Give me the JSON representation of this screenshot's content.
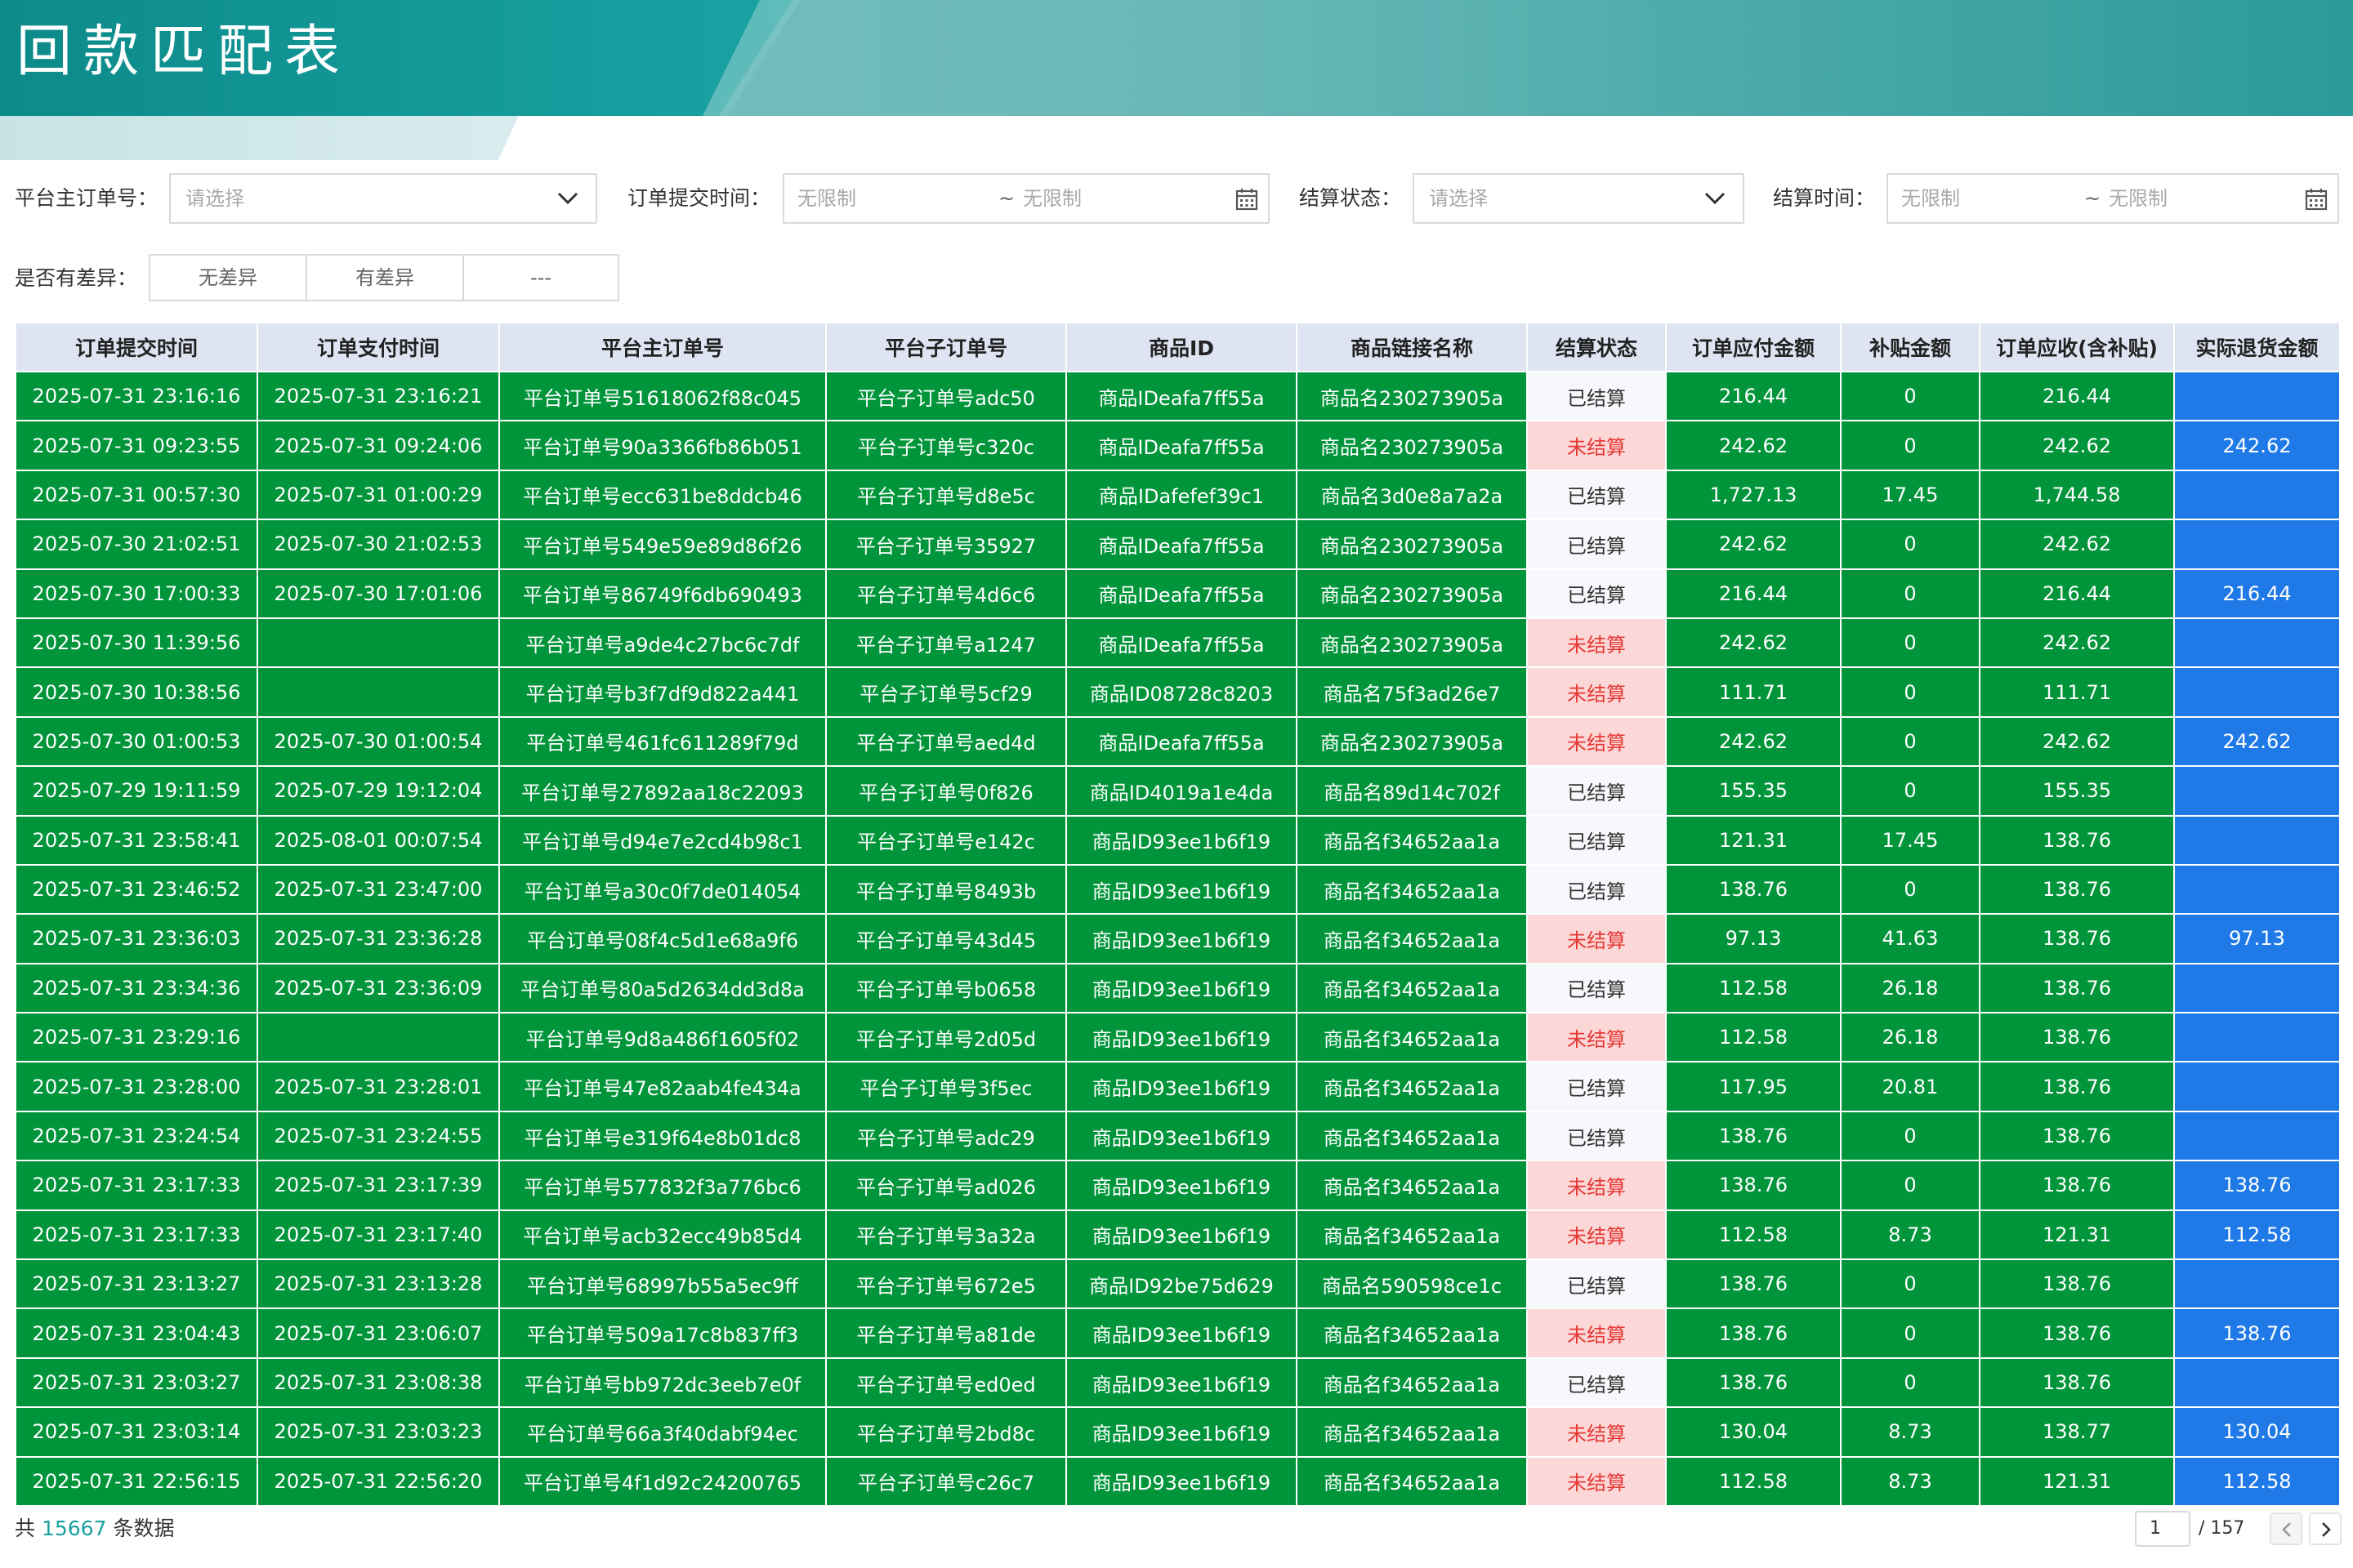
{
  "page": {
    "title": "回款匹配表"
  },
  "filters": {
    "main_order": {
      "label": "平台主订单号：",
      "placeholder": "请选择"
    },
    "submit_time": {
      "label": "订单提交时间：",
      "start": "无限制",
      "sep": "~",
      "end": "无限制"
    },
    "settle_status": {
      "label": "结算状态：",
      "placeholder": "请选择"
    },
    "settle_time": {
      "label": "结算时间：",
      "start": "无限制",
      "sep": "~",
      "end": "无限制"
    },
    "diff": {
      "label": "是否有差异：",
      "options": [
        "无差异",
        "有差异",
        "---"
      ]
    }
  },
  "table": {
    "columns": [
      "订单提交时间",
      "订单支付时间",
      "平台主订单号",
      "平台子订单号",
      "商品ID",
      "商品链接名称",
      "结算状态",
      "订单应付金额",
      "补贴金额",
      "订单应收(含补贴)",
      "实际退货金额"
    ],
    "rows": [
      [
        "2025-07-31 23:16:16",
        "2025-07-31 23:16:21",
        "平台订单号51618062f88c045",
        "平台子订单号adc50",
        "商品IDeafa7ff55a",
        "商品名230273905a",
        "已结算",
        "216.44",
        "0",
        "216.44",
        ""
      ],
      [
        "2025-07-31 09:23:55",
        "2025-07-31 09:24:06",
        "平台订单号90a3366fb86b051",
        "平台子订单号c320c",
        "商品IDeafa7ff55a",
        "商品名230273905a",
        "未结算",
        "242.62",
        "0",
        "242.62",
        "242.62"
      ],
      [
        "2025-07-31 00:57:30",
        "2025-07-31 01:00:29",
        "平台订单号ecc631be8ddcb46",
        "平台子订单号d8e5c",
        "商品IDafefef39c1",
        "商品名3d0e8a7a2a",
        "已结算",
        "1,727.13",
        "17.45",
        "1,744.58",
        ""
      ],
      [
        "2025-07-30 21:02:51",
        "2025-07-30 21:02:53",
        "平台订单号549e59e89d86f26",
        "平台子订单号35927",
        "商品IDeafa7ff55a",
        "商品名230273905a",
        "已结算",
        "242.62",
        "0",
        "242.62",
        ""
      ],
      [
        "2025-07-30 17:00:33",
        "2025-07-30 17:01:06",
        "平台订单号86749f6db690493",
        "平台子订单号4d6c6",
        "商品IDeafa7ff55a",
        "商品名230273905a",
        "已结算",
        "216.44",
        "0",
        "216.44",
        "216.44"
      ],
      [
        "2025-07-30 11:39:56",
        "",
        "平台订单号a9de4c27bc6c7df",
        "平台子订单号a1247",
        "商品IDeafa7ff55a",
        "商品名230273905a",
        "未结算",
        "242.62",
        "0",
        "242.62",
        ""
      ],
      [
        "2025-07-30 10:38:56",
        "",
        "平台订单号b3f7df9d822a441",
        "平台子订单号5cf29",
        "商品ID08728c8203",
        "商品名75f3ad26e7",
        "未结算",
        "111.71",
        "0",
        "111.71",
        ""
      ],
      [
        "2025-07-30 01:00:53",
        "2025-07-30 01:00:54",
        "平台订单号461fc611289f79d",
        "平台子订单号aed4d",
        "商品IDeafa7ff55a",
        "商品名230273905a",
        "未结算",
        "242.62",
        "0",
        "242.62",
        "242.62"
      ],
      [
        "2025-07-29 19:11:59",
        "2025-07-29 19:12:04",
        "平台订单号27892aa18c22093",
        "平台子订单号0f826",
        "商品ID4019a1e4da",
        "商品名89d14c702f",
        "已结算",
        "155.35",
        "0",
        "155.35",
        ""
      ],
      [
        "2025-07-31 23:58:41",
        "2025-08-01 00:07:54",
        "平台订单号d94e7e2cd4b98c1",
        "平台子订单号e142c",
        "商品ID93ee1b6f19",
        "商品名f34652aa1a",
        "已结算",
        "121.31",
        "17.45",
        "138.76",
        ""
      ],
      [
        "2025-07-31 23:46:52",
        "2025-07-31 23:47:00",
        "平台订单号a30c0f7de014054",
        "平台子订单号8493b",
        "商品ID93ee1b6f19",
        "商品名f34652aa1a",
        "已结算",
        "138.76",
        "0",
        "138.76",
        ""
      ],
      [
        "2025-07-31 23:36:03",
        "2025-07-31 23:36:28",
        "平台订单号08f4c5d1e68a9f6",
        "平台子订单号43d45",
        "商品ID93ee1b6f19",
        "商品名f34652aa1a",
        "未结算",
        "97.13",
        "41.63",
        "138.76",
        "97.13"
      ],
      [
        "2025-07-31 23:34:36",
        "2025-07-31 23:36:09",
        "平台订单号80a5d2634dd3d8a",
        "平台子订单号b0658",
        "商品ID93ee1b6f19",
        "商品名f34652aa1a",
        "已结算",
        "112.58",
        "26.18",
        "138.76",
        ""
      ],
      [
        "2025-07-31 23:29:16",
        "",
        "平台订单号9d8a486f1605f02",
        "平台子订单号2d05d",
        "商品ID93ee1b6f19",
        "商品名f34652aa1a",
        "未结算",
        "112.58",
        "26.18",
        "138.76",
        ""
      ],
      [
        "2025-07-31 23:28:00",
        "2025-07-31 23:28:01",
        "平台订单号47e82aab4fe434a",
        "平台子订单号3f5ec",
        "商品ID93ee1b6f19",
        "商品名f34652aa1a",
        "已结算",
        "117.95",
        "20.81",
        "138.76",
        ""
      ],
      [
        "2025-07-31 23:24:54",
        "2025-07-31 23:24:55",
        "平台订单号e319f64e8b01dc8",
        "平台子订单号adc29",
        "商品ID93ee1b6f19",
        "商品名f34652aa1a",
        "已结算",
        "138.76",
        "0",
        "138.76",
        ""
      ],
      [
        "2025-07-31 23:17:33",
        "2025-07-31 23:17:39",
        "平台订单号577832f3a776bc6",
        "平台子订单号ad026",
        "商品ID93ee1b6f19",
        "商品名f34652aa1a",
        "未结算",
        "138.76",
        "0",
        "138.76",
        "138.76"
      ],
      [
        "2025-07-31 23:17:33",
        "2025-07-31 23:17:40",
        "平台订单号acb32ecc49b85d4",
        "平台子订单号3a32a",
        "商品ID93ee1b6f19",
        "商品名f34652aa1a",
        "未结算",
        "112.58",
        "8.73",
        "121.31",
        "112.58"
      ],
      [
        "2025-07-31 23:13:27",
        "2025-07-31 23:13:28",
        "平台订单号68997b55a5ec9ff",
        "平台子订单号672e5",
        "商品ID92be75d629",
        "商品名590598ce1c",
        "已结算",
        "138.76",
        "0",
        "138.76",
        ""
      ],
      [
        "2025-07-31 23:04:43",
        "2025-07-31 23:06:07",
        "平台订单号509a17c8b837ff3",
        "平台子订单号a81de",
        "商品ID93ee1b6f19",
        "商品名f34652aa1a",
        "未结算",
        "138.76",
        "0",
        "138.76",
        "138.76"
      ],
      [
        "2025-07-31 23:03:27",
        "2025-07-31 23:08:38",
        "平台订单号bb972dc3eeb7e0f",
        "平台子订单号ed0ed",
        "商品ID93ee1b6f19",
        "商品名f34652aa1a",
        "已结算",
        "138.76",
        "0",
        "138.76",
        ""
      ],
      [
        "2025-07-31 23:03:14",
        "2025-07-31 23:03:23",
        "平台订单号66a3f40dabf94ec",
        "平台子订单号2bd8c",
        "商品ID93ee1b6f19",
        "商品名f34652aa1a",
        "未结算",
        "130.04",
        "8.73",
        "138.77",
        "130.04"
      ],
      [
        "2025-07-31 22:56:15",
        "2025-07-31 22:56:20",
        "平台订单号4f1d92c24200765",
        "平台子订单号c26c7",
        "商品ID93ee1b6f19",
        "商品名f34652aa1a",
        "未结算",
        "112.58",
        "8.73",
        "121.31",
        "112.58"
      ]
    ]
  },
  "footer": {
    "total_prefix": "共",
    "total_count": "15667",
    "total_suffix": "条数据"
  },
  "pagination": {
    "current": "1",
    "total": "/ 157"
  },
  "colors": {
    "row_green": "#00953a",
    "refund_blue": "#1f7ae8",
    "unsettled_bg": "#fcd7d7",
    "unsettled_text": "#e53935",
    "header_teal": "#0e8f8f",
    "accent_teal": "#1aa0a0"
  },
  "icons": [
    "chevron-down-icon",
    "calendar-icon",
    "chevron-left-icon",
    "chevron-right-icon"
  ]
}
